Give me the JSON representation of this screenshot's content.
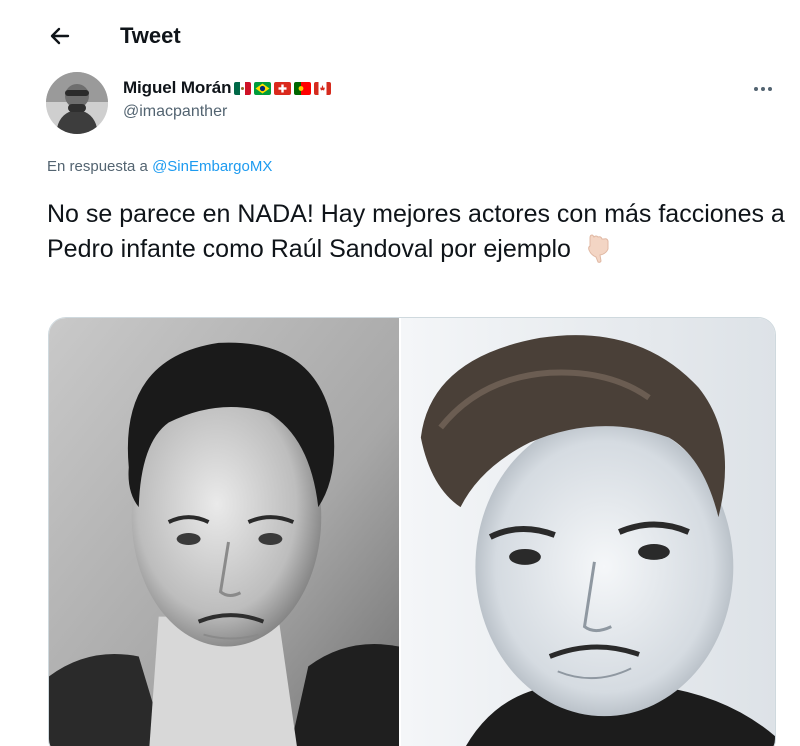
{
  "header": {
    "title": "Tweet",
    "back_icon": "arrow-left-icon"
  },
  "author": {
    "name": "Miguel Morán",
    "handle": "@imacpanther",
    "flags": [
      "mexico-flag-icon",
      "brazil-flag-icon",
      "switzerland-flag-icon",
      "portugal-flag-icon",
      "canada-flag-icon"
    ],
    "more_icon": "more-horizontal-icon"
  },
  "reply": {
    "prefix": "En respuesta a",
    "mention": "@SinEmbargoMX"
  },
  "tweet": {
    "text": "No se parece en NADA! Hay mejores actores con más facciones a Pedro infante como Raúl Sandoval por ejemplo",
    "emoji_icon": "pointing-down-hand-icon"
  },
  "media": {
    "photos": [
      "portrait-photo-left",
      "portrait-photo-right"
    ]
  },
  "colors": {
    "text": "#0f1419",
    "secondary": "#536471",
    "link": "#1d9bf0",
    "border": "#cfd9de"
  }
}
